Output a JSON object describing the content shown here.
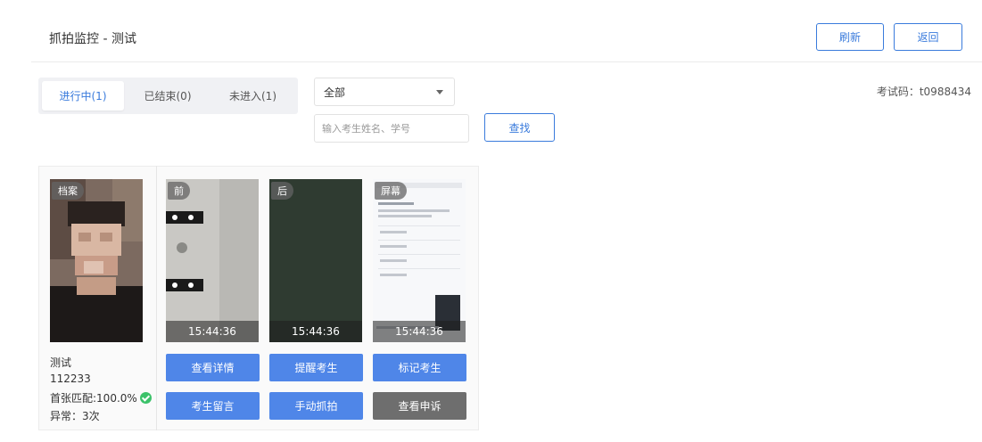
{
  "header": {
    "title": "抓拍监控 - 测试",
    "refresh_label": "刷新",
    "back_label": "返回"
  },
  "tabs": [
    {
      "label": "进行中(1)",
      "active": true
    },
    {
      "label": "已结束(0)",
      "active": false
    },
    {
      "label": "未进入(1)",
      "active": false
    }
  ],
  "filter": {
    "selected": "全部",
    "search_placeholder": "输入考生姓名、学号",
    "search_label": "查找"
  },
  "exam_code": "考试码：t0988434",
  "student": {
    "name": "测试",
    "id": "112233",
    "match": "首张匹配:100.0%",
    "anomaly": "异常：3次"
  },
  "photos": {
    "profile_tag": "档案",
    "front_tag": "前",
    "back_tag": "后",
    "screen_tag": "屏幕",
    "front_time": "15:44:36",
    "back_time": "15:44:36",
    "screen_time": "15:44:36"
  },
  "actions": {
    "view_details": "查看详情",
    "remind": "提醒考生",
    "mark": "标记考生",
    "message": "考生留言",
    "manual_capture": "手动抓拍",
    "view_appeal": "查看申诉"
  },
  "colors": {
    "accent": "#3a7bdc",
    "action_blue": "#4f86e8",
    "action_gray": "#6e6e6e",
    "success": "#3cc26a"
  }
}
